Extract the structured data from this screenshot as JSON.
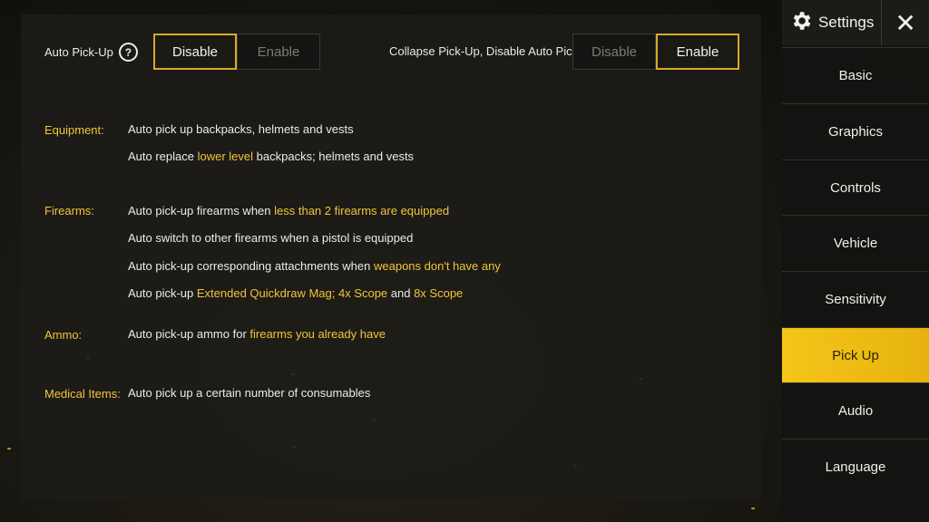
{
  "toggles": {
    "auto_pickup": {
      "label": "Auto Pick-Up",
      "help_icon": "?",
      "options": [
        "Disable",
        "Enable"
      ],
      "selected": "Disable"
    },
    "collapse_pickup": {
      "label": "Collapse Pick-Up, Disable Auto Pick-Up",
      "options": [
        "Disable",
        "Enable"
      ],
      "selected": "Enable"
    }
  },
  "sections": {
    "equipment": {
      "label": "Equipment:",
      "line1": "Auto pick up backpacks, helmets and vests",
      "line2_a": "Auto replace ",
      "line2_hl": "lower level",
      "line2_b": " backpacks; helmets and vests"
    },
    "firearms": {
      "label": "Firearms:",
      "line1_a": "Auto pick-up firearms when ",
      "line1_hl": "less than 2 firearms are equipped",
      "line2": "Auto switch to other firearms when a pistol is equipped",
      "line3_a": "Auto pick-up corresponding attachments when ",
      "line3_hl": "weapons don't have any",
      "line4_a": "Auto pick-up ",
      "line4_hl1": "Extended Quickdraw Mag; 4x Scope",
      "line4_b": " and ",
      "line4_hl2": "8x Scope"
    },
    "ammo": {
      "label": "Ammo:",
      "line1_a": "Auto pick-up ammo for ",
      "line1_hl": "firearms you already have"
    },
    "medical": {
      "label": "Medical Items:",
      "line1": "Auto pick up a certain number of consumables"
    }
  },
  "sidebar": {
    "title": "Settings",
    "close": "✕",
    "items": [
      "Basic",
      "Graphics",
      "Controls",
      "Vehicle",
      "Sensitivity",
      "Pick Up",
      "Audio",
      "Language"
    ],
    "active": "Pick Up"
  },
  "colors": {
    "accent": "#f0c53a",
    "active_tab": "#f5c518",
    "active_border": "#d8a92b"
  },
  "icons": {
    "gear": "gear-icon",
    "close": "close-icon",
    "help": "help-icon"
  }
}
